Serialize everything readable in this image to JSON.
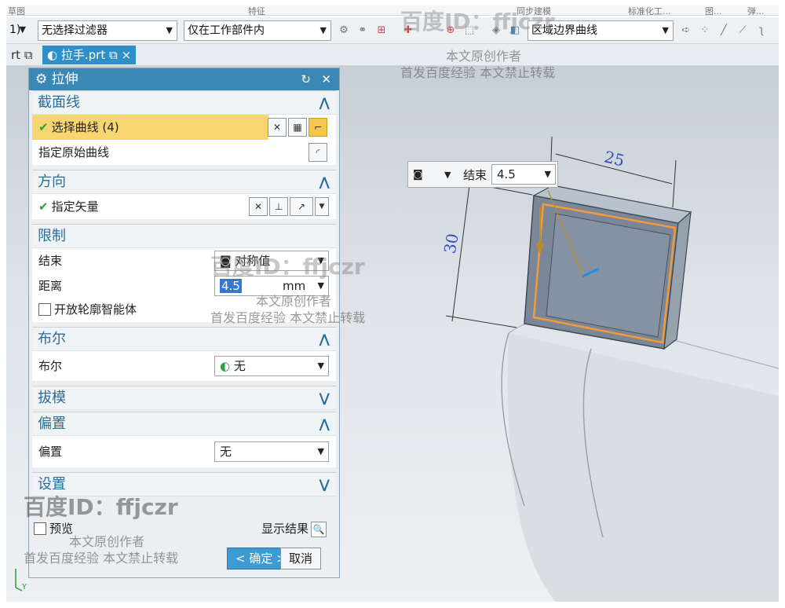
{
  "ribbon": {
    "left_label": "草图",
    "center_label": "特征",
    "right1": "同步建模",
    "right2": "标准化工...",
    "right3": "图...",
    "right4": "弹..."
  },
  "selbar": {
    "type_filter_suffix": "1)",
    "filter": "无选择过滤器",
    "scope": "仅在工作部件内",
    "curve_rule": "区域边界曲线"
  },
  "tabs": [
    {
      "label": "rt"
    },
    {
      "label": "拉手.prt"
    }
  ],
  "dialog": {
    "title": "拉伸",
    "section_curve": {
      "heading": "截面线",
      "select_curve": "选择曲线 (4)",
      "specify_origin": "指定原始曲线"
    },
    "section_direction": {
      "heading": "方向",
      "specify_vector": "指定矢量"
    },
    "section_limits": {
      "heading": "限制",
      "end_label": "结束",
      "end_value": "对称值",
      "distance_label": "距离",
      "distance_value": "4.5",
      "distance_unit": "mm",
      "open_profile": "开放轮廓智能体"
    },
    "section_boolean": {
      "heading": "布尔",
      "boolean_label": "布尔",
      "boolean_value": "无"
    },
    "section_draft": {
      "heading": "拔模"
    },
    "section_offset": {
      "heading": "偏置",
      "offset_label": "偏置",
      "offset_value": "无"
    },
    "section_settings": {
      "heading": "设置"
    },
    "preview_label": "预览",
    "show_result": "显示结果",
    "ok": "< 确定 >",
    "cancel": "取消"
  },
  "float_input": {
    "label": "结束",
    "value": "4.5"
  },
  "dimensions": {
    "width": "25",
    "height": "30"
  },
  "axis_label": "Y",
  "watermarks": {
    "id": "百度ID：ffjczr",
    "line1": "本文原创作者",
    "line2": "首发百度经验  本文禁止转载"
  },
  "colors": {
    "accent": "#3c88b5",
    "highlight": "#f7d571",
    "sketch": "#f39b3c"
  }
}
